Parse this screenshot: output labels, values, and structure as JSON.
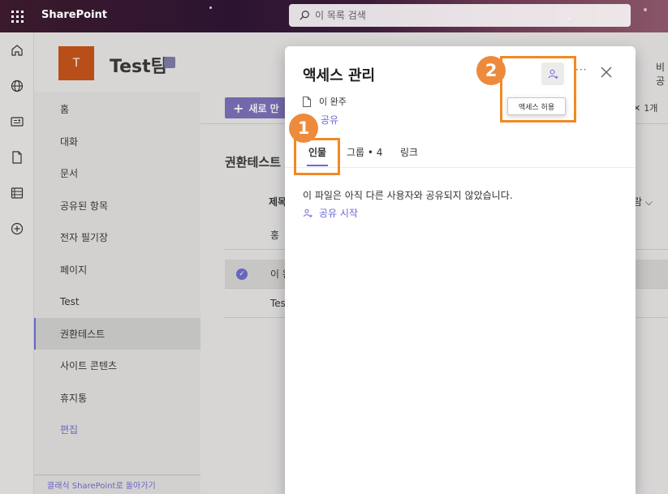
{
  "suitebar": {
    "brand": "SharePoint",
    "search_placeholder": "이 목록 검색"
  },
  "appbar": {
    "icons": [
      "home-icon",
      "globe-icon",
      "news-icon",
      "document-icon",
      "list-icon",
      "add-icon"
    ]
  },
  "site": {
    "logo_letter": "T",
    "title": "Test팀",
    "header_right_partial": "비공"
  },
  "leftnav": {
    "items": [
      {
        "label": "홈"
      },
      {
        "label": "대화"
      },
      {
        "label": "문서"
      },
      {
        "label": "공유된 항목"
      },
      {
        "label": "전자 필기장"
      },
      {
        "label": "페이지"
      },
      {
        "label": "Test"
      },
      {
        "label": "권환테스트",
        "selected": true
      },
      {
        "label": "사이트 콘텐츠"
      },
      {
        "label": "휴지통"
      }
    ],
    "edit_label": "편집",
    "classic_link": "클래식 SharePoint로 돌아가기"
  },
  "content": {
    "new_button_label": "새로 만",
    "cmd_right_partial": "1개",
    "library_title_partial": "권환테스트",
    "column_header_partial": "제목",
    "column_right_partial": "람",
    "rows": [
      {
        "name_partial": "홍"
      },
      {
        "name_partial": "이 완"
      },
      {
        "name_partial": "Test"
      }
    ]
  },
  "dialog": {
    "title": "액세스 관리",
    "file_name": "이 완주",
    "share_link": "공유",
    "grant_tooltip": "액세스 허용",
    "more_label": "···",
    "tabs": [
      {
        "label": "인물",
        "active": true
      },
      {
        "label": "그룹 • 4"
      },
      {
        "label": "링크"
      }
    ],
    "empty_message": "이 파일은 아직 다른 사용자와 공유되지 않았습니다.",
    "start_sharing": "공유 시작"
  },
  "annotations": {
    "badge1": "1",
    "badge2": "2",
    "color": "#f08a24"
  },
  "colors": {
    "accent": "#6b69d6",
    "site_logo": "#ca5010"
  }
}
